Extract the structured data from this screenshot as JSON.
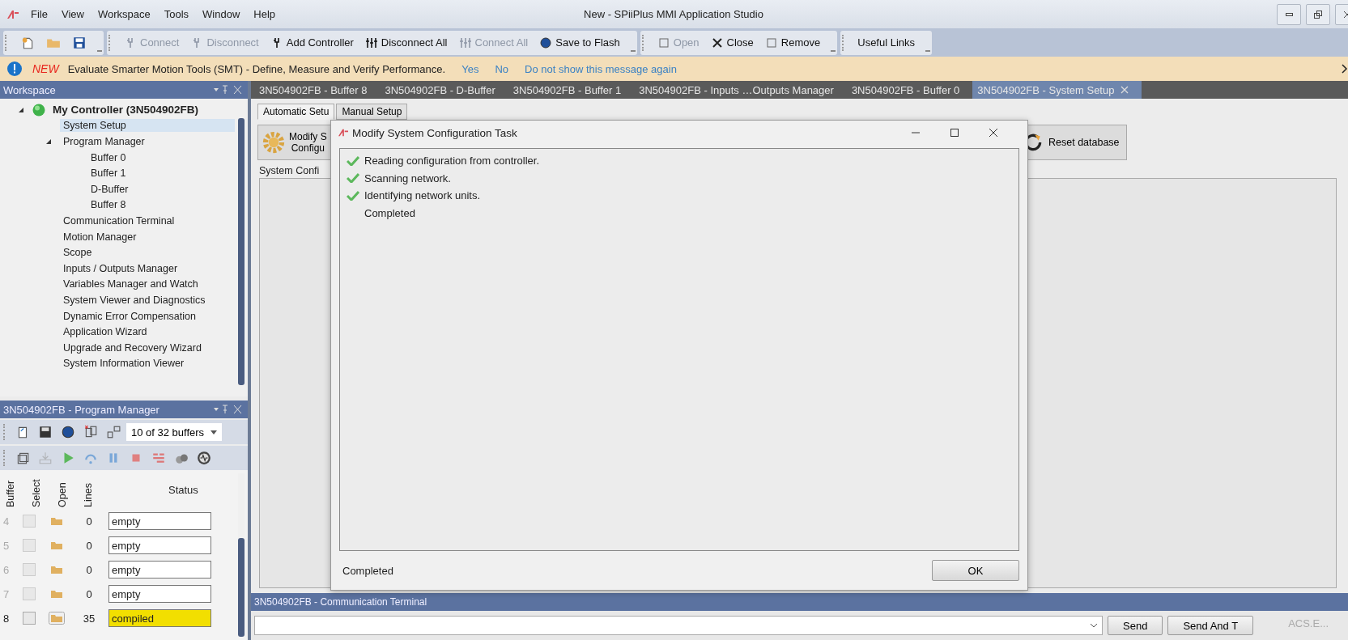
{
  "window": {
    "title": "New - SPiiPlus MMI Application Studio"
  },
  "menu": [
    "File",
    "View",
    "Workspace",
    "Tools",
    "Window",
    "Help"
  ],
  "toolbar": {
    "groups": [
      [
        {
          "label": "Connect",
          "disabled": true
        },
        {
          "label": "Disconnect",
          "disabled": true
        },
        {
          "label": "Add Controller",
          "disabled": false
        },
        {
          "label": "Disconnect All",
          "disabled": false
        },
        {
          "label": "Connect All",
          "disabled": true
        },
        {
          "label": "Save to Flash",
          "disabled": false
        }
      ],
      [
        {
          "label": "Open",
          "disabled": true
        },
        {
          "label": "Close",
          "disabled": false
        },
        {
          "label": "Remove",
          "disabled": false
        }
      ],
      [
        {
          "label": "Useful Links",
          "disabled": false
        }
      ]
    ]
  },
  "message_bar": {
    "tag": "NEW",
    "text": "Evaluate Smarter Motion Tools (SMT) - Define, Measure and Verify Performance.",
    "links": [
      "Yes",
      "No",
      "Do not show this message again"
    ]
  },
  "workspace": {
    "title": "Workspace",
    "tree": [
      {
        "label": "My Controller (3N504902FB)",
        "expanded": true,
        "selected": false,
        "children": [
          {
            "label": "System Setup",
            "selected": true
          },
          {
            "label": "Program Manager",
            "expanded": true,
            "selected": false,
            "children": [
              {
                "label": "Buffer 0",
                "selected": false
              },
              {
                "label": "Buffer 1",
                "selected": false
              },
              {
                "label": "D-Buffer",
                "selected": false
              },
              {
                "label": "Buffer 8",
                "selected": false
              }
            ]
          },
          {
            "label": "Communication Terminal",
            "selected": false
          },
          {
            "label": "Motion Manager",
            "selected": false
          },
          {
            "label": "Scope",
            "selected": false
          },
          {
            "label": "Inputs / Outputs Manager",
            "selected": false
          },
          {
            "label": "Variables Manager and Watch",
            "selected": false
          },
          {
            "label": "System Viewer and Diagnostics",
            "selected": false
          },
          {
            "label": "Dynamic Error Compensation",
            "selected": false
          },
          {
            "label": "Application Wizard",
            "selected": false
          },
          {
            "label": "Upgrade and Recovery Wizard",
            "selected": false
          },
          {
            "label": "System Information Viewer",
            "selected": false
          }
        ]
      }
    ]
  },
  "program_manager": {
    "title": "3N504902FB - Program Manager",
    "buffers_select": "10 of 32 buffers",
    "columns": [
      "Buffer",
      "Select",
      "Open",
      "Lines",
      "Status"
    ],
    "rows": [
      {
        "buffer": "4",
        "checked": false,
        "disabled": true,
        "lines": "0",
        "status": "empty",
        "color": "#ffffff"
      },
      {
        "buffer": "5",
        "checked": false,
        "disabled": true,
        "lines": "0",
        "status": "empty",
        "color": "#ffffff"
      },
      {
        "buffer": "6",
        "checked": false,
        "disabled": true,
        "lines": "0",
        "status": "empty",
        "color": "#ffffff"
      },
      {
        "buffer": "7",
        "checked": false,
        "disabled": true,
        "lines": "0",
        "status": "empty",
        "color": "#ffffff"
      },
      {
        "buffer": "8",
        "checked": false,
        "disabled": false,
        "lines": "35",
        "status": "compiled",
        "color": "#f2df00"
      }
    ]
  },
  "doc_tabs": [
    {
      "label": "3N504902FB - Buffer 8",
      "selected": false
    },
    {
      "label": "3N504902FB - D-Buffer",
      "selected": false
    },
    {
      "label": "3N504902FB - Buffer 1",
      "selected": false
    },
    {
      "label": "3N504902FB - Inputs …Outputs Manager",
      "selected": false
    },
    {
      "label": "3N504902FB - Buffer 0",
      "selected": false
    },
    {
      "label": "3N504902FB - System Setup",
      "selected": true
    }
  ],
  "setup": {
    "tabs": [
      {
        "label": "Automatic Setu",
        "selected": true
      },
      {
        "label": "Manual Setup",
        "selected": false
      }
    ],
    "modify_button": [
      "Modify S",
      "Configu"
    ],
    "reset_button": "Reset database",
    "group_label": "System Confi"
  },
  "dialog": {
    "title": "Modify System Configuration Task",
    "log": [
      {
        "text": "Reading configuration from controller.",
        "done": true
      },
      {
        "text": "Scanning network.",
        "done": true
      },
      {
        "text": "Identifying network units.",
        "done": true
      },
      {
        "text": "Completed",
        "done": false
      }
    ],
    "status": "Completed",
    "ok": "OK"
  },
  "terminal": {
    "title": "3N504902FB - Communication Terminal",
    "buttons": [
      "Send",
      "Send And T"
    ],
    "tooltip": "ACS.E..."
  }
}
